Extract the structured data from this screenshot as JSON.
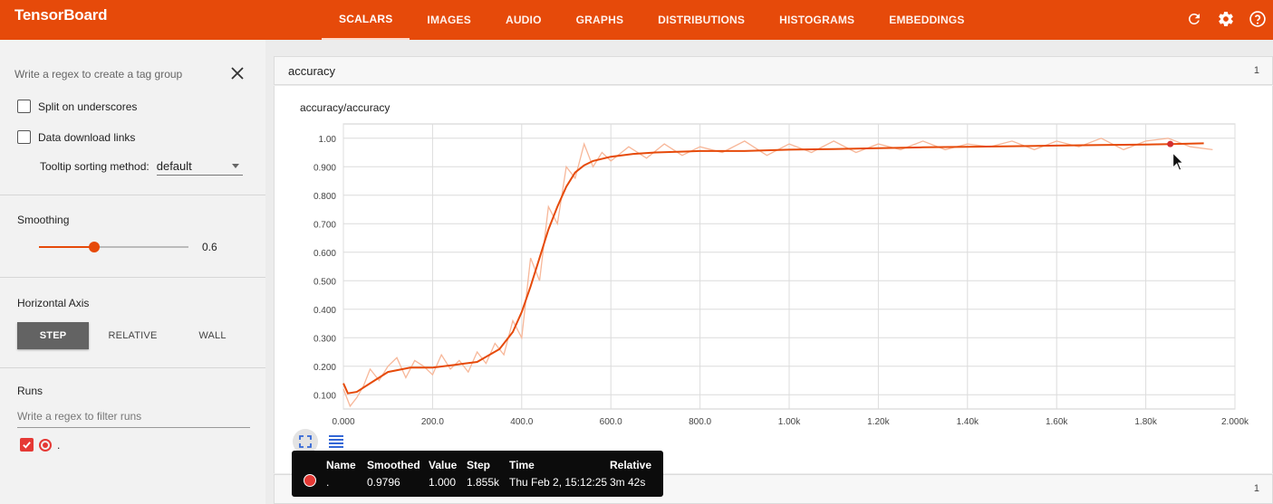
{
  "app": {
    "title": "TensorBoard"
  },
  "nav": {
    "tabs": [
      {
        "label": "SCALARS",
        "active": true
      },
      {
        "label": "IMAGES"
      },
      {
        "label": "AUDIO"
      },
      {
        "label": "GRAPHS"
      },
      {
        "label": "DISTRIBUTIONS"
      },
      {
        "label": "HISTOGRAMS"
      },
      {
        "label": "EMBEDDINGS"
      }
    ],
    "icons": [
      "refresh-icon",
      "settings-gear-icon",
      "help-icon"
    ]
  },
  "sidebar": {
    "tag_regex_placeholder": "Write a regex to create a tag group",
    "split_underscores_label": "Split on underscores",
    "data_download_label": "Data download links",
    "tooltip_sort_label": "Tooltip sorting method:",
    "tooltip_sort_value": "default",
    "smoothing_title": "Smoothing",
    "smoothing_value": "0.6",
    "smoothing_level": 0.6,
    "axis_title": "Horizontal Axis",
    "axis_options": [
      "STEP",
      "RELATIVE",
      "WALL"
    ],
    "axis_selected": "STEP",
    "runs_title": "Runs",
    "runs_filter_placeholder": "Write a regex to filter runs",
    "runs": [
      {
        "name": ".",
        "checked": true,
        "color": "#e53935"
      }
    ]
  },
  "main": {
    "group_title": "accuracy",
    "group_count": "1",
    "card_title": "accuracy/accuracy",
    "next_group_count": "1"
  },
  "tooltip": {
    "headers": [
      "Name",
      "Smoothed",
      "Value",
      "Step",
      "Time",
      "Relative"
    ],
    "row": {
      ".": ".",
      "name": ".",
      "smoothed": "0.9796",
      "value": "1.000",
      "step": "1.855k",
      "time": "Thu Feb 2, 15:12:25",
      "relative": "3m 42s"
    },
    "color": "#e53935"
  },
  "chart_data": {
    "type": "line",
    "title": "accuracy/accuracy",
    "xlim": [
      0,
      2000
    ],
    "ylim": [
      0.05,
      1.05
    ],
    "x_ticks": [
      "0.000",
      "200.0",
      "400.0",
      "600.0",
      "800.0",
      "1.00k",
      "1.20k",
      "1.40k",
      "1.60k",
      "1.80k",
      "2.000k"
    ],
    "x_tick_values": [
      0,
      200,
      400,
      600,
      800,
      1000,
      1200,
      1400,
      1600,
      1800,
      2000
    ],
    "y_ticks": [
      "0.100",
      "0.200",
      "0.300",
      "0.400",
      "0.500",
      "0.600",
      "0.700",
      "0.800",
      "0.900",
      "1.00"
    ],
    "y_tick_values": [
      0.1,
      0.2,
      0.3,
      0.4,
      0.5,
      0.6,
      0.7,
      0.8,
      0.9,
      1.0
    ],
    "grid": true,
    "series": [
      {
        "kind": "smoothed",
        "color": "#e64a0a",
        "x": [
          0,
          10,
          30,
          60,
          100,
          150,
          200,
          250,
          300,
          350,
          380,
          400,
          420,
          440,
          460,
          480,
          500,
          520,
          540,
          560,
          600,
          650,
          700,
          800,
          900,
          1000,
          1100,
          1200,
          1300,
          1400,
          1500,
          1600,
          1700,
          1800,
          1855,
          1930
        ],
        "y": [
          0.14,
          0.105,
          0.11,
          0.14,
          0.18,
          0.195,
          0.195,
          0.205,
          0.215,
          0.26,
          0.32,
          0.39,
          0.48,
          0.58,
          0.68,
          0.76,
          0.83,
          0.88,
          0.905,
          0.92,
          0.935,
          0.945,
          0.95,
          0.955,
          0.955,
          0.96,
          0.962,
          0.965,
          0.968,
          0.97,
          0.972,
          0.974,
          0.976,
          0.978,
          0.9796,
          0.982
        ]
      },
      {
        "kind": "raw",
        "color": "#f7b799",
        "x": [
          0,
          15,
          30,
          45,
          60,
          80,
          100,
          120,
          140,
          160,
          180,
          200,
          220,
          240,
          260,
          280,
          300,
          320,
          340,
          360,
          380,
          400,
          420,
          440,
          460,
          480,
          500,
          520,
          540,
          560,
          580,
          600,
          640,
          680,
          720,
          760,
          800,
          850,
          900,
          950,
          1000,
          1050,
          1100,
          1150,
          1200,
          1250,
          1300,
          1350,
          1400,
          1450,
          1500,
          1550,
          1600,
          1650,
          1700,
          1750,
          1800,
          1850,
          1900,
          1950
        ],
        "y": [
          0.12,
          0.06,
          0.09,
          0.13,
          0.19,
          0.15,
          0.2,
          0.23,
          0.16,
          0.22,
          0.2,
          0.17,
          0.24,
          0.19,
          0.22,
          0.18,
          0.25,
          0.21,
          0.28,
          0.24,
          0.36,
          0.3,
          0.58,
          0.5,
          0.76,
          0.7,
          0.9,
          0.86,
          0.98,
          0.9,
          0.95,
          0.92,
          0.97,
          0.93,
          0.98,
          0.94,
          0.97,
          0.95,
          0.99,
          0.94,
          0.98,
          0.95,
          0.99,
          0.95,
          0.98,
          0.96,
          0.99,
          0.96,
          0.98,
          0.97,
          0.99,
          0.96,
          0.99,
          0.97,
          1.0,
          0.96,
          0.99,
          1.0,
          0.97,
          0.96
        ]
      }
    ],
    "highlight_point": {
      "x": 1855,
      "y": 0.9796
    }
  }
}
